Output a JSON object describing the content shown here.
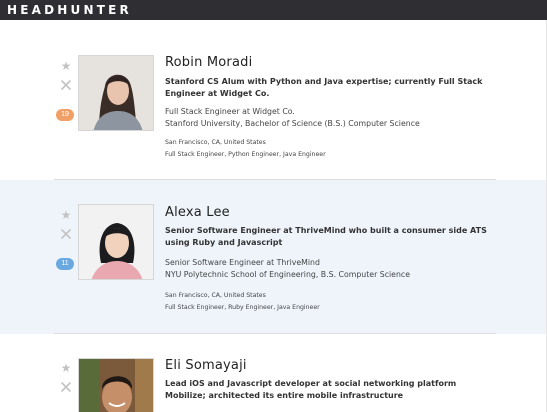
{
  "app": {
    "brand": "HEADHUNTER"
  },
  "candidates": [
    {
      "name": "Robin Moradi",
      "headline": "Stanford CS Alum with Python and Java expertise; currently Full Stack Engineer at Widget Co.",
      "position": "Full Stack Engineer at Widget Co.",
      "education": "Stanford University, Bachelor of Science (B.S.) Computer Science",
      "location": "San Francisco, CA, United States",
      "roles": "Full Stack Engineer, Python Engineer, Java Engineer",
      "badge": "19",
      "badge_color": "#f0a066"
    },
    {
      "name": "Alexa Lee",
      "headline": "Senior Software Engineer at ThriveMind who built a consumer side ATS using Ruby and Javascript",
      "position": "Senior Software Engineer at ThriveMind",
      "education": "NYU Polytechnic School of Engineering, B.S. Computer Science",
      "location": "San Francisco, CA, United States",
      "roles": "Full Stack Engineer, Ruby Engineer, Java Engineer",
      "badge": "11",
      "badge_color": "#6aa9e0"
    },
    {
      "name": "Eli Somayaji",
      "headline": "Lead iOS and Javascript developer at social networking platform Mobilize; architected its entire mobile infrastructure"
    }
  ],
  "icons": {
    "favorite": "star-icon",
    "dismiss": "close-icon"
  },
  "colors": {
    "topbar": "#2f2f33",
    "highlight": "#eff4fb",
    "icon": "#c3c3c3"
  }
}
